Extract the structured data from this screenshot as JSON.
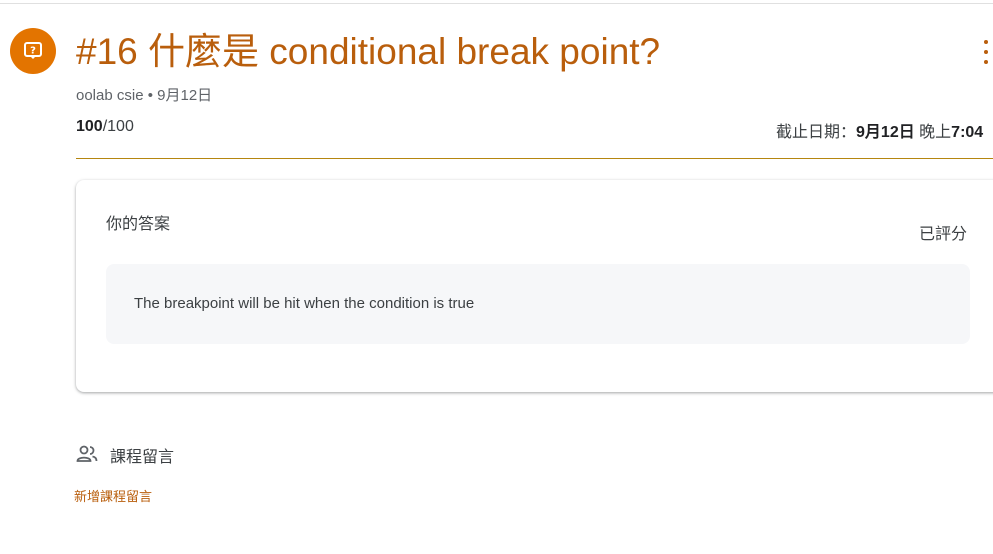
{
  "assignment": {
    "icon": "assignment-question-icon",
    "title": "#16 什麼是 conditional break point?",
    "author": "oolab csie",
    "posted_date": "9月12日",
    "points_earned": "100",
    "points_total": "/100",
    "due_label": "截止日期：",
    "due_date": "9月12日",
    "due_time_prefix": " 晚上",
    "due_time": "7:04"
  },
  "your_work": {
    "title": "你的答案",
    "status": "已評分",
    "answer": "The breakpoint will be hit when the condition is true"
  },
  "class_comments": {
    "icon": "people-icon",
    "label": "課程留言",
    "add_link": "新增課程留言"
  },
  "colors": {
    "accent": "#b95e0c",
    "icon_bg": "#e37400",
    "divider": "#b5860f"
  }
}
